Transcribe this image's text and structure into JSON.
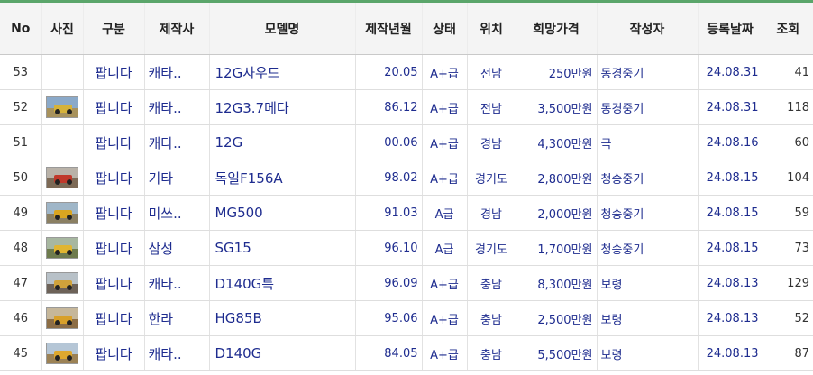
{
  "headers": {
    "no": "No",
    "photo": "사진",
    "type": "구분",
    "maker": "제작사",
    "model": "모델명",
    "year": "제작년월",
    "status": "상태",
    "location": "위치",
    "price": "희망가격",
    "author": "작성자",
    "date": "등록날짜",
    "views": "조회"
  },
  "rows": [
    {
      "no": "53",
      "photo": "",
      "photo_icon": "none",
      "type": "팝니다",
      "maker": "캐타..",
      "model": "12G사우드",
      "year": "20.05",
      "status": "A+급",
      "location": "전남",
      "price": "250만원",
      "author": "동경중기",
      "date": "24.08.31",
      "views": "41"
    },
    {
      "no": "52",
      "photo": "grader-photo",
      "photo_icon": "grader",
      "sky": "#8aa9c9",
      "ground": "#a8925c",
      "body": "#d6b23a",
      "type": "팝니다",
      "maker": "캐타..",
      "model": "12G3.7메다",
      "year": "86.12",
      "status": "A+급",
      "location": "전남",
      "price": "3,500만원",
      "author": "동경중기",
      "date": "24.08.31",
      "views": "118"
    },
    {
      "no": "51",
      "photo": "",
      "photo_icon": "none",
      "type": "팝니다",
      "maker": "캐타..",
      "model": "12G",
      "year": "00.06",
      "status": "A+급",
      "location": "경남",
      "price": "4,300만원",
      "author": "극",
      "date": "24.08.16",
      "views": "60"
    },
    {
      "no": "50",
      "photo": "grader-photo",
      "photo_icon": "grader",
      "sky": "#b9b2a8",
      "ground": "#7d6a56",
      "body": "#c0392b",
      "type": "팝니다",
      "maker": "기타",
      "model": "독일F156A",
      "year": "98.02",
      "status": "A+급",
      "location": "경기도",
      "price": "2,800만원",
      "author": "청송중기",
      "date": "24.08.15",
      "views": "104"
    },
    {
      "no": "49",
      "photo": "grader-photo",
      "photo_icon": "grader",
      "sky": "#9fb6c8",
      "ground": "#8b8063",
      "body": "#d9a520",
      "type": "팝니다",
      "maker": "미쓰..",
      "model": "MG500",
      "year": "91.03",
      "status": "A급",
      "location": "경남",
      "price": "2,000만원",
      "author": "청송중기",
      "date": "24.08.15",
      "views": "59"
    },
    {
      "no": "48",
      "photo": "grader-photo",
      "photo_icon": "grader",
      "sky": "#a7b7a0",
      "ground": "#6e7b4d",
      "body": "#e0b531",
      "type": "팝니다",
      "maker": "삼성",
      "model": "SG15",
      "year": "96.10",
      "status": "A급",
      "location": "경기도",
      "price": "1,700만원",
      "author": "청송중기",
      "date": "24.08.15",
      "views": "73"
    },
    {
      "no": "47",
      "photo": "grader-photo",
      "photo_icon": "grader",
      "sky": "#b8c1c8",
      "ground": "#6d6258",
      "body": "#cfa23b",
      "type": "팝니다",
      "maker": "캐타..",
      "model": "D140G특",
      "year": "96.09",
      "status": "A+급",
      "location": "충남",
      "price": "8,300만원",
      "author": "보령",
      "date": "24.08.13",
      "views": "129"
    },
    {
      "no": "46",
      "photo": "grader-photo",
      "photo_icon": "grader",
      "sky": "#c6b79a",
      "ground": "#8c6d45",
      "body": "#d8a02a",
      "type": "팝니다",
      "maker": "한라",
      "model": "HG85B",
      "year": "95.06",
      "status": "A+급",
      "location": "충남",
      "price": "2,500만원",
      "author": "보령",
      "date": "24.08.13",
      "views": "52"
    },
    {
      "no": "45",
      "photo": "grader-photo",
      "photo_icon": "grader",
      "sky": "#b5c6d6",
      "ground": "#9c8255",
      "body": "#dda82e",
      "type": "팝니다",
      "maker": "캐타..",
      "model": "D140G",
      "year": "84.05",
      "status": "A+급",
      "location": "충남",
      "price": "5,500만원",
      "author": "보령",
      "date": "24.08.13",
      "views": "87"
    }
  ]
}
